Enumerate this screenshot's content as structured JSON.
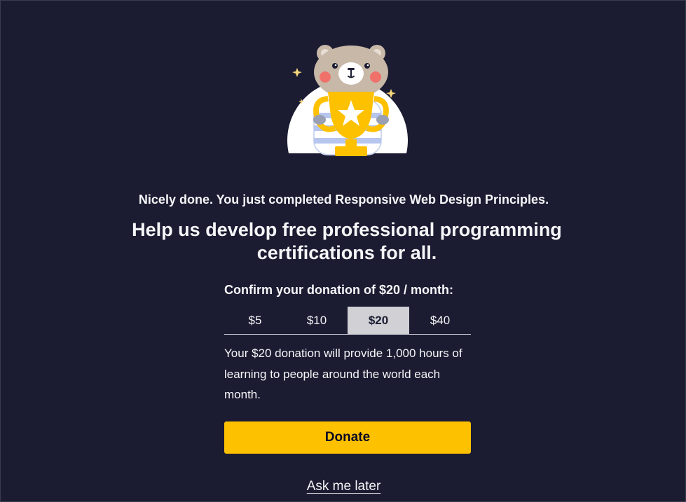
{
  "modal": {
    "completed_text": "Nicely done. You just completed Responsive Web Design Principles.",
    "headline": "Help us develop free professional programming certifications for all.",
    "confirm_text": "Confirm your donation of $20 / month:",
    "amount_tabs": [
      {
        "label": "$5",
        "selected": false
      },
      {
        "label": "$10",
        "selected": false
      },
      {
        "label": "$20",
        "selected": true
      },
      {
        "label": "$40",
        "selected": false
      }
    ],
    "provide_text": "Your $20 donation will provide 1,000 hours of learning to people around the world each month.",
    "donate_label": "Donate",
    "ask_later_label": "Ask me later"
  },
  "illustration": {
    "icon": "bear-trophy-illustration"
  },
  "colors": {
    "background": "#1b1b32",
    "text": "#f5f6f7",
    "donate_button": "#fec100",
    "selected_tab": "#d0d0d5"
  }
}
